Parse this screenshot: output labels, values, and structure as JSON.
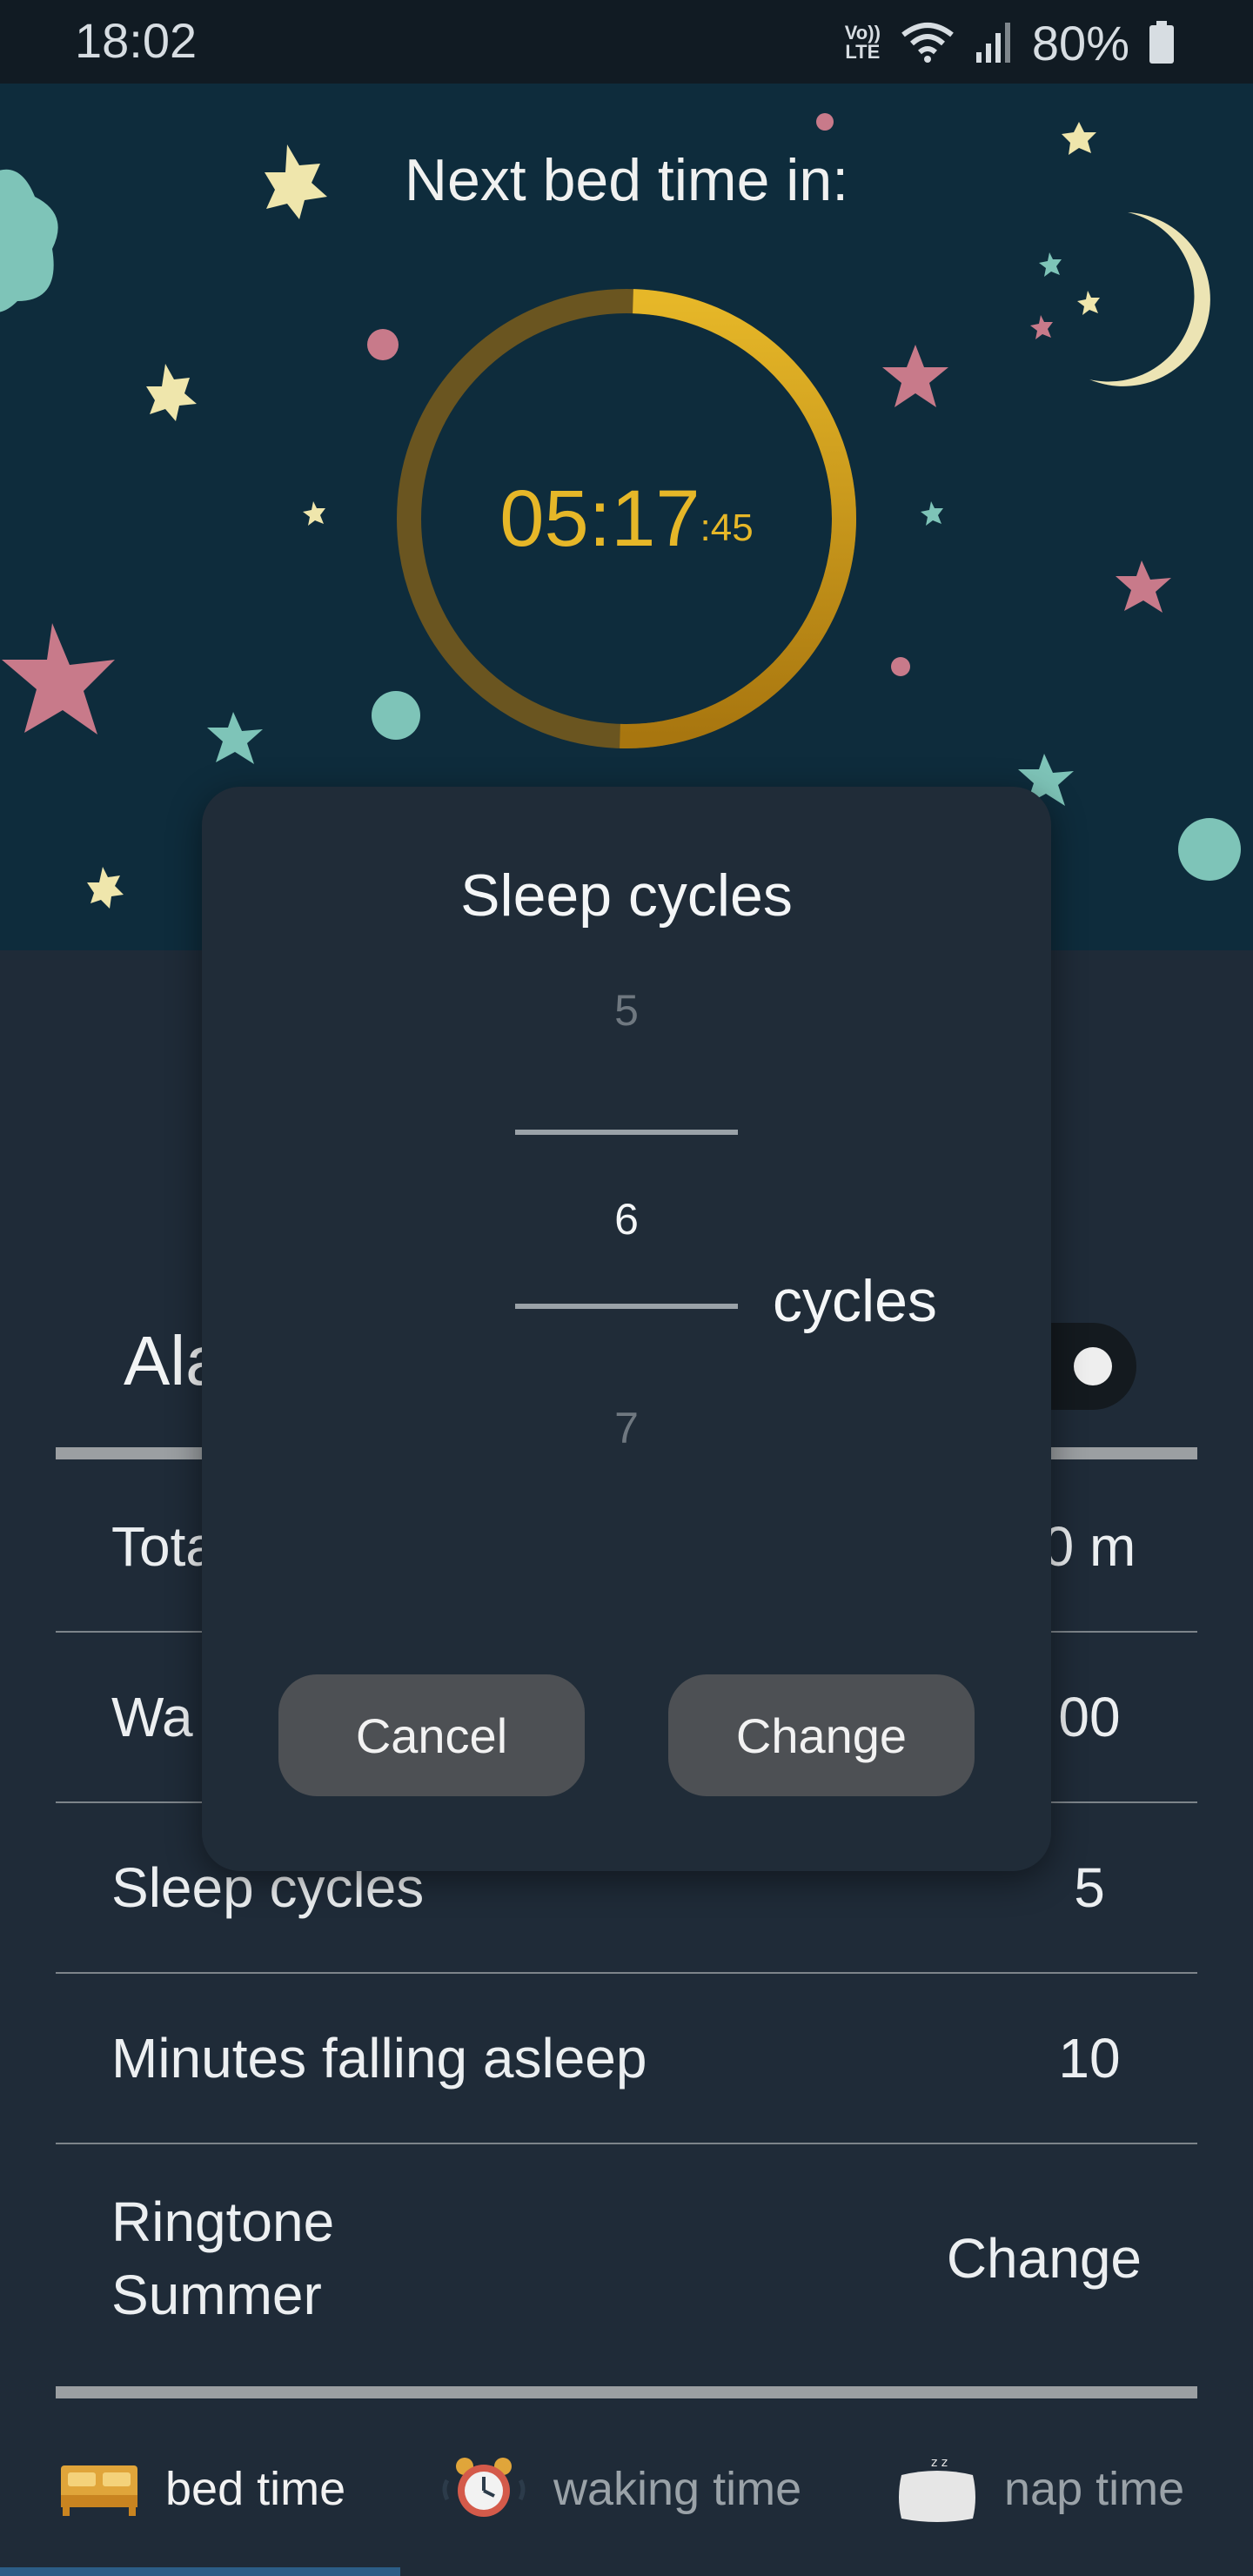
{
  "status_bar": {
    "time": "18:02",
    "volte": "Vo)) LTE",
    "battery": "80%"
  },
  "hero": {
    "title": "Next bed time in:",
    "countdown_main": "05:17",
    "countdown_seconds": ":45",
    "progress_fraction": 0.5,
    "ring_color": "#e6b728"
  },
  "settings": {
    "alarm_label": "Alarm",
    "alarm_enabled": true,
    "rows": [
      {
        "label": "Total",
        "value": "0 m"
      },
      {
        "label": "Wa",
        "value": "00"
      },
      {
        "label": "Sleep cycles",
        "value": "5"
      },
      {
        "label": "Minutes falling asleep",
        "value": "10"
      },
      {
        "label_line1": "Ringtone",
        "label_line2": "Summer",
        "value": "Change"
      }
    ]
  },
  "dialog": {
    "title": "Sleep cycles",
    "picker": {
      "previous": "5",
      "selected": "6",
      "next": "7"
    },
    "unit": "cycles",
    "cancel": "Cancel",
    "confirm": "Change"
  },
  "bottom_nav": {
    "items": [
      {
        "label": "bed time",
        "icon": "bed-icon",
        "active": true
      },
      {
        "label": "waking time",
        "icon": "alarm-clock-icon",
        "active": false
      },
      {
        "label": "nap time",
        "icon": "pillow-icon",
        "active": false
      }
    ]
  },
  "colors": {
    "accent": "#e6b728",
    "hero_bg": "#0e2c3c",
    "app_bg": "#1f2b38",
    "dialog_bg": "#202c38"
  }
}
